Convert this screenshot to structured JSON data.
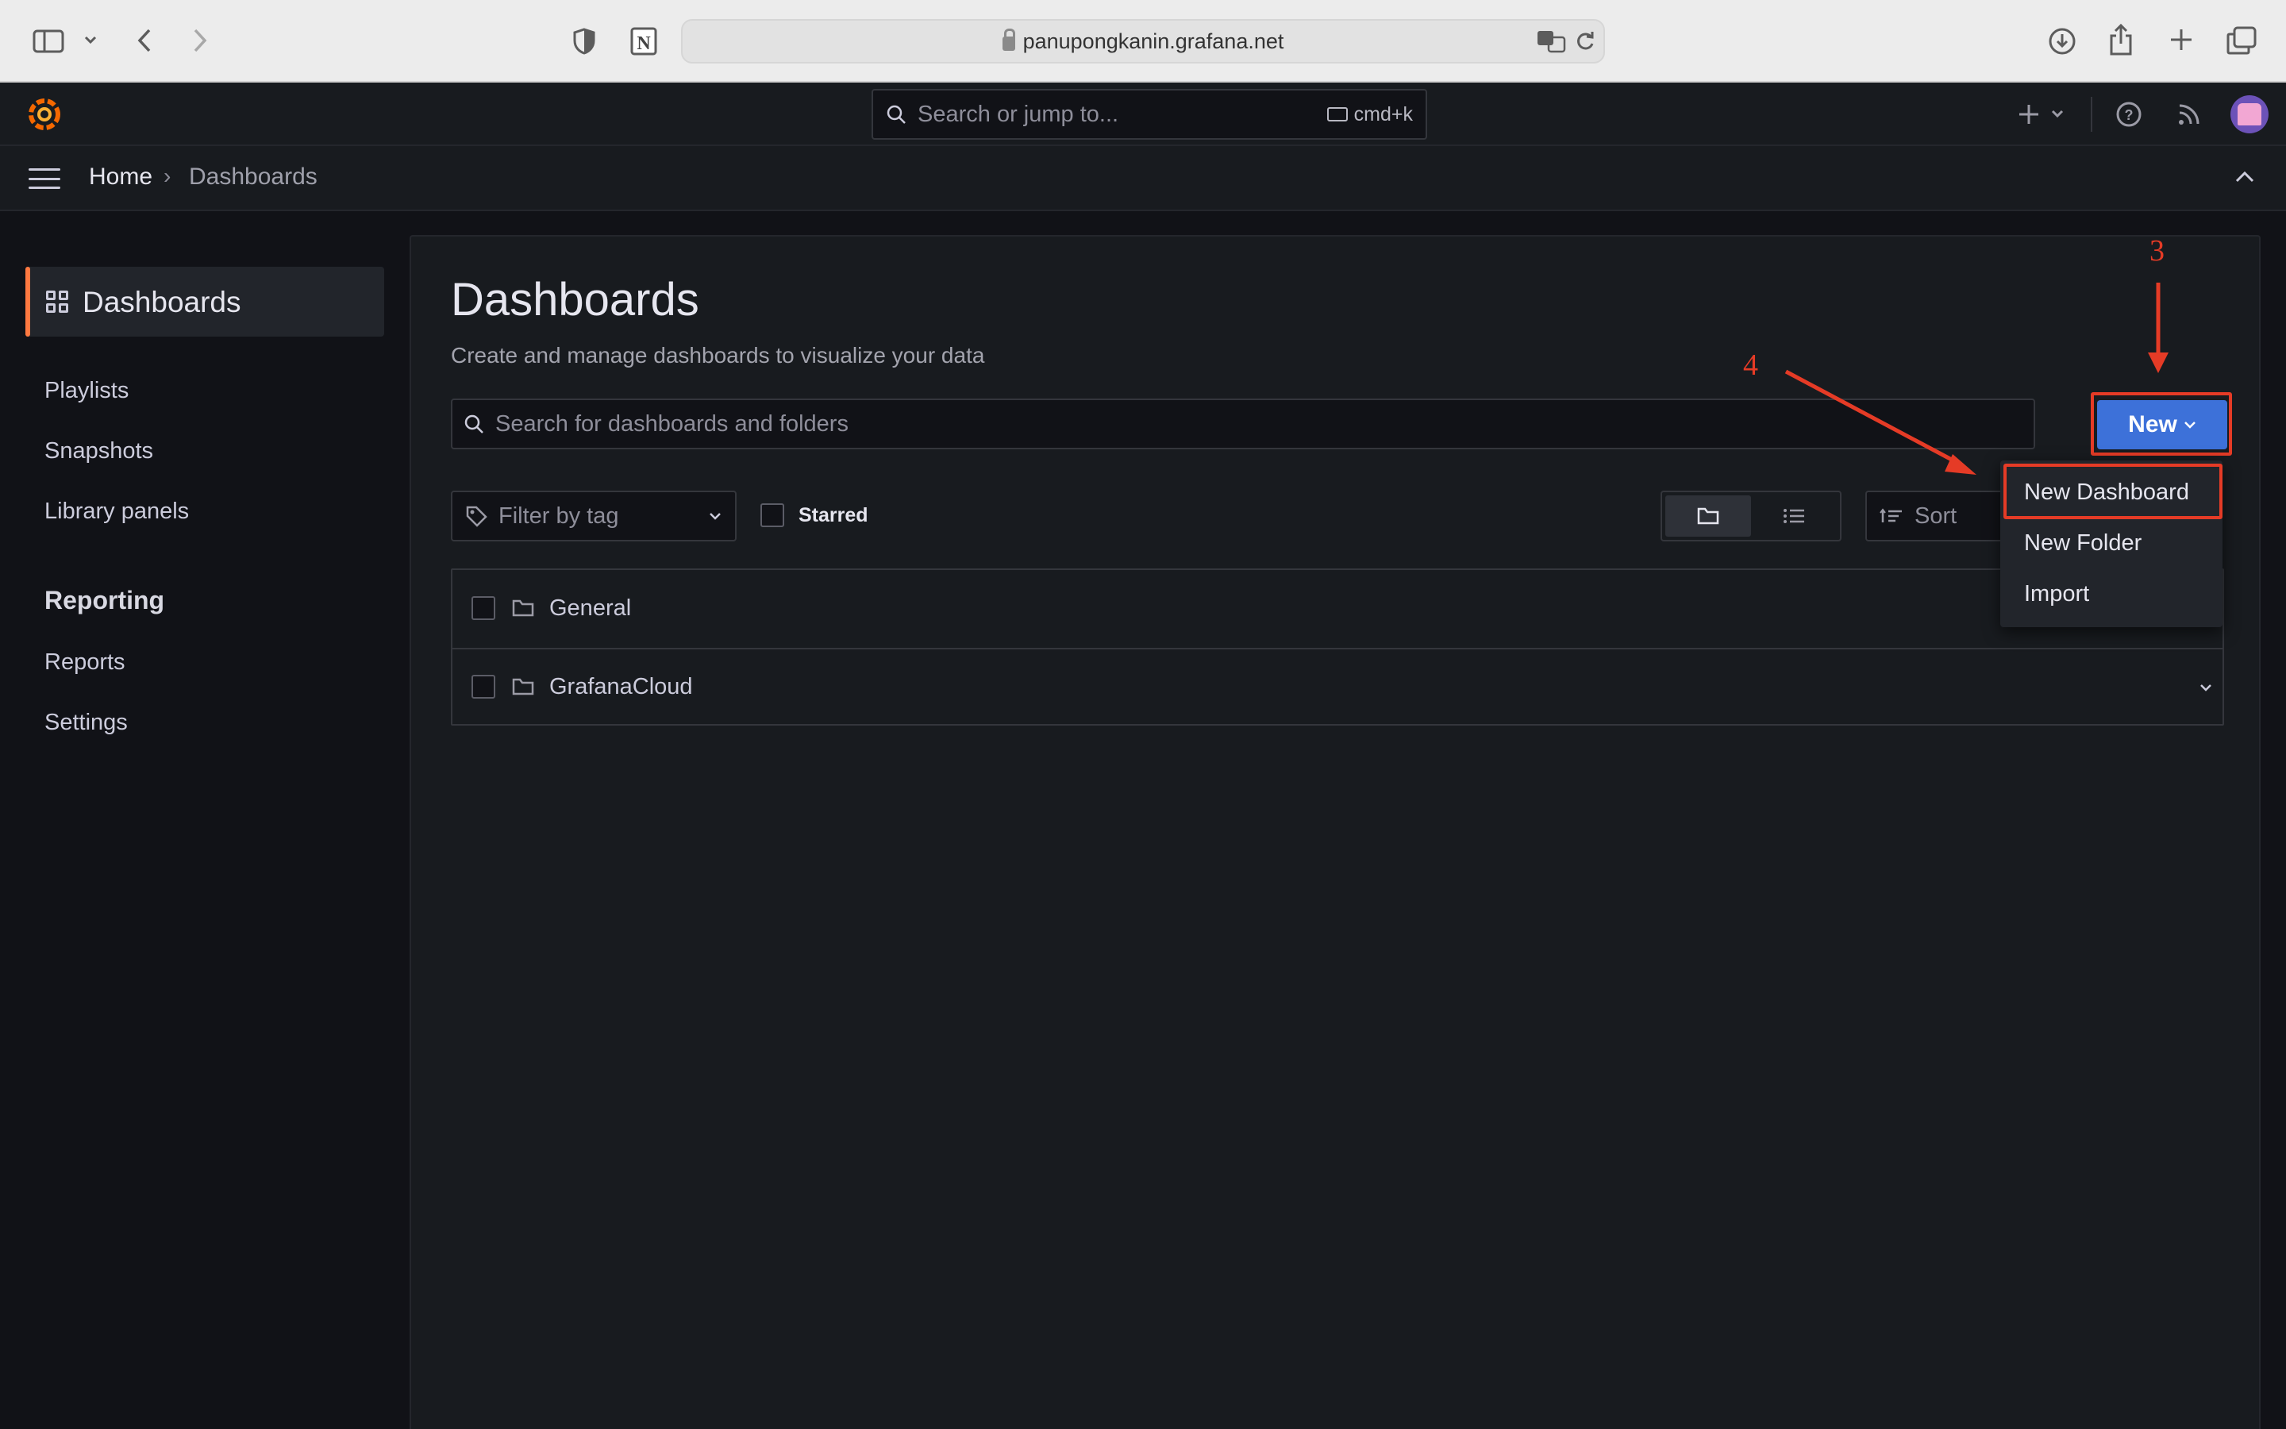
{
  "browser": {
    "url": "panupongkanin.grafana.net"
  },
  "topnav": {
    "search_placeholder": "Search or jump to...",
    "shortcut": "cmd+k"
  },
  "breadcrumb": {
    "home": "Home",
    "separator": "›",
    "current": "Dashboards"
  },
  "sidebar": {
    "active": "Dashboards",
    "items": [
      "Playlists",
      "Snapshots",
      "Library panels"
    ],
    "section": "Reporting",
    "section_items": [
      "Reports",
      "Settings"
    ]
  },
  "main": {
    "title": "Dashboards",
    "subtitle": "Create and manage dashboards to visualize your data",
    "search_placeholder": "Search for dashboards and folders",
    "new_button": "New",
    "filter_placeholder": "Filter by tag",
    "starred_label": "Starred",
    "sort_label": "Sort",
    "folders": [
      "General",
      "GrafanaCloud"
    ]
  },
  "new_menu": {
    "items": [
      "New Dashboard",
      "New Folder",
      "Import"
    ]
  },
  "annotations": {
    "step3": "3",
    "step4": "4"
  },
  "colors": {
    "accent": "#ff7941",
    "primary_button": "#3d71d9",
    "annotation": "#e53b26"
  }
}
